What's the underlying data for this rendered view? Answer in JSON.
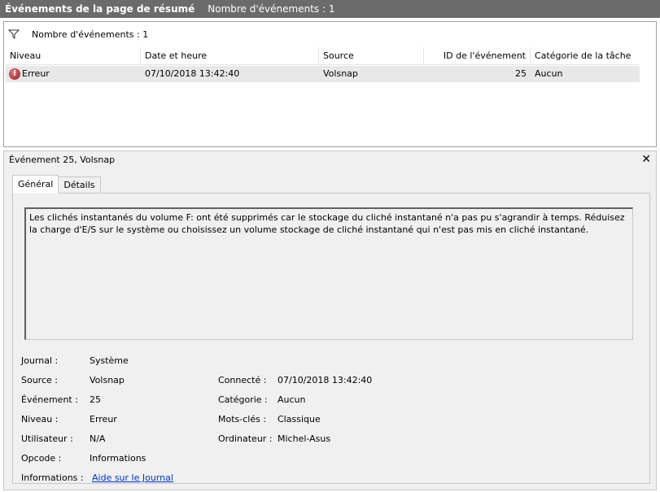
{
  "titlebar": {
    "title": "Événements de la page de résumé",
    "count": "Nombre d'événements : 1"
  },
  "filter": {
    "icon": "filter-icon",
    "text": "Nombre d'événements : 1"
  },
  "table": {
    "columns": [
      "Niveau",
      "Date et heure",
      "Source",
      "ID de l'événement",
      "Catégorie de la tâche"
    ],
    "rows": [
      {
        "icon": "error-icon",
        "level": "Erreur",
        "datetime": "07/10/2018 13:42:40",
        "source": "Volsnap",
        "event_id": "25",
        "category": "Aucun"
      }
    ]
  },
  "detail": {
    "header": "Événement 25, Volsnap",
    "close_glyph": "✕",
    "tabs": [
      "Général",
      "Détails"
    ],
    "description": "Les clichés instantanés du volume F: ont été supprimés car le stockage du cliché instantané n'a pas pu s'agrandir à temps. Réduisez la charge d'E/S sur le système ou choisissez un volume stockage de cliché instantané qui n'est pas mis en cliché instantané.",
    "props": {
      "journal_label": "Journal :",
      "journal_value": "Système",
      "source_label": "Source :",
      "source_value": "Volsnap",
      "event_label": "Événement :",
      "event_value": "25",
      "level_label": "Niveau :",
      "level_value": "Erreur",
      "user_label": "Utilisateur :",
      "user_value": "N/A",
      "opcode_label": "Opcode :",
      "opcode_value": "Informations",
      "info_label": "Informations :",
      "info_link": "Aide sur le Journal",
      "logged_label": "Connecté :",
      "logged_value": "07/10/2018 13:42:40",
      "category_label": "Catégorie :",
      "category_value": "Aucun",
      "keywords_label": "Mots-clés :",
      "keywords_value": "Classique",
      "computer_label": "Ordinateur :",
      "computer_value": "Michel-Asus"
    }
  }
}
